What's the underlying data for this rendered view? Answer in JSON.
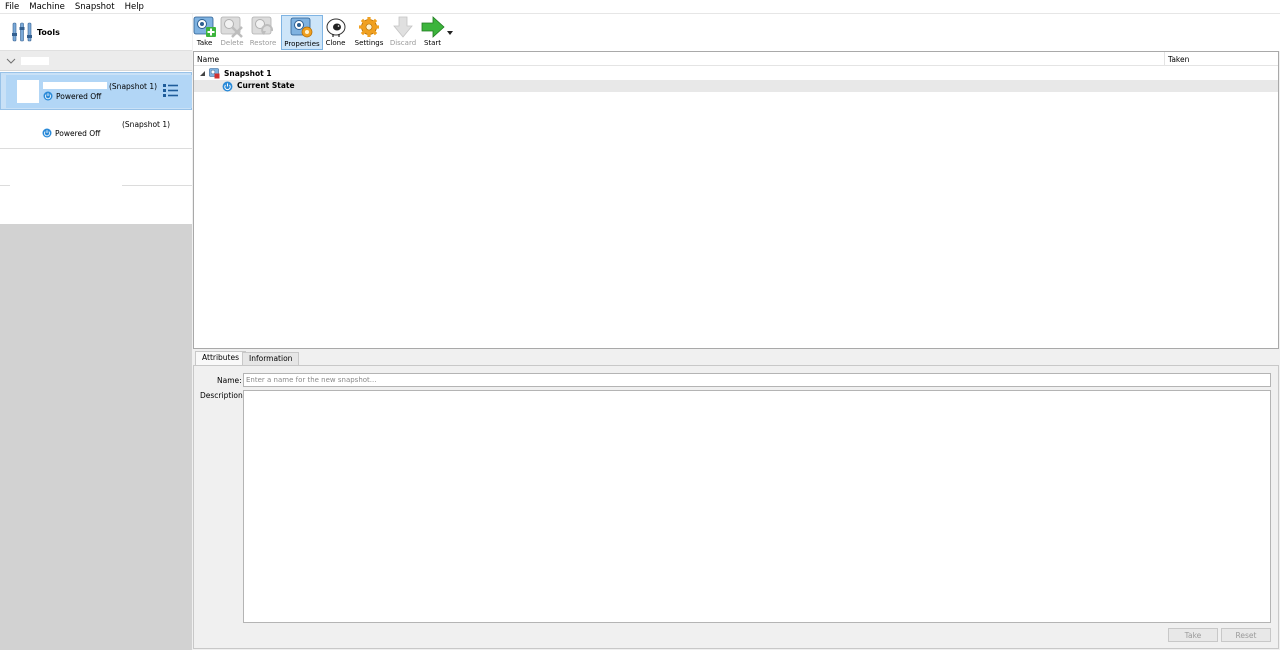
{
  "menu": [
    "File",
    "Machine",
    "Snapshot",
    "Help"
  ],
  "left": {
    "tools_label": "Tools",
    "vms": [
      {
        "snapshot": "(Snapshot 1)",
        "state": "Powered Off",
        "selected": true
      },
      {
        "snapshot": "(Snapshot 1)",
        "state": "Powered Off",
        "selected": false
      }
    ]
  },
  "toolbar": {
    "take": "Take",
    "delete": "Delete",
    "restore": "Restore",
    "properties": "Properties",
    "clone": "Clone",
    "settings": "Settings",
    "discard": "Discard",
    "start": "Start"
  },
  "tree": {
    "col_name": "Name",
    "col_taken": "Taken",
    "snapshot_name": "Snapshot 1",
    "current_state": "Current State"
  },
  "details": {
    "tab_attributes": "Attributes",
    "tab_information": "Information",
    "name_label": "Name:",
    "name_placeholder": "Enter a name for the new snapshot...",
    "description_label": "Description:",
    "take_button": "Take",
    "reset_button": "Reset"
  },
  "colors": {
    "selection": "#b2d6f6",
    "accent_blue": "#1e6fc2",
    "start_green": "#3cb43c",
    "settings_orange": "#f0a020"
  }
}
